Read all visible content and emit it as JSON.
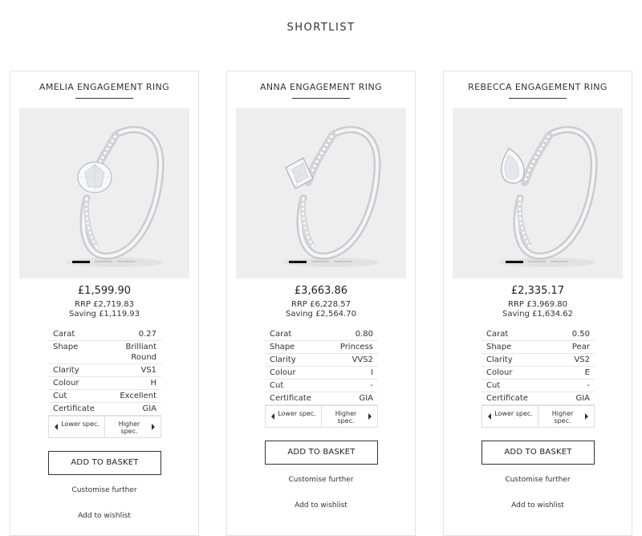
{
  "page": {
    "title": "SHORTLIST"
  },
  "products": [
    {
      "name": "AMELIA ENGAGEMENT RING",
      "price": "£1,599.90",
      "rrp": "RRP £2,719.83",
      "saving": "Saving £1,119.93",
      "specs": [
        {
          "label": "Carat",
          "value": "0.27"
        },
        {
          "label": "Shape",
          "value": "Brilliant Round"
        },
        {
          "label": "Clarity",
          "value": "VS1"
        },
        {
          "label": "Colour",
          "value": "H"
        },
        {
          "label": "Cut",
          "value": "Excellent"
        },
        {
          "label": "Certificate",
          "value": "GIA"
        }
      ],
      "lower_spec": "Lower spec.",
      "higher_spec": "Higher spec.",
      "add_to_basket": "ADD TO BASKET",
      "customise": "Customise further",
      "wishlist": "Add to wishlist",
      "stone_shape": "round-stone",
      "carousel_active": 0
    },
    {
      "name": "ANNA ENGAGEMENT RING",
      "price": "£3,663.86",
      "rrp": "RRP £6,228.57",
      "saving": "Saving £2,564.70",
      "specs": [
        {
          "label": "Carat",
          "value": "0.80"
        },
        {
          "label": "Shape",
          "value": "Princess"
        },
        {
          "label": "Clarity",
          "value": "VVS2"
        },
        {
          "label": "Colour",
          "value": "I"
        },
        {
          "label": "Cut",
          "value": "-"
        },
        {
          "label": "Certificate",
          "value": "GIA"
        }
      ],
      "lower_spec": "Lower spec.",
      "higher_spec": "Higher spec.",
      "add_to_basket": "ADD TO BASKET",
      "customise": "Customise further",
      "wishlist": "Add to wishlist",
      "stone_shape": "princess-stone",
      "carousel_active": 0
    },
    {
      "name": "REBECCA ENGAGEMENT RING",
      "price": "£2,335.17",
      "rrp": "RRP £3,969.80",
      "saving": "Saving £1,634.62",
      "specs": [
        {
          "label": "Carat",
          "value": "0.50"
        },
        {
          "label": "Shape",
          "value": "Pear"
        },
        {
          "label": "Clarity",
          "value": "VS2"
        },
        {
          "label": "Colour",
          "value": "E"
        },
        {
          "label": "Cut",
          "value": "-"
        },
        {
          "label": "Certificate",
          "value": "GIA"
        }
      ],
      "lower_spec": "Lower spec.",
      "higher_spec": "Higher spec.",
      "add_to_basket": "ADD TO BASKET",
      "customise": "Customise further",
      "wishlist": "Add to wishlist",
      "stone_shape": "pear-stone",
      "carousel_active": 0
    }
  ]
}
